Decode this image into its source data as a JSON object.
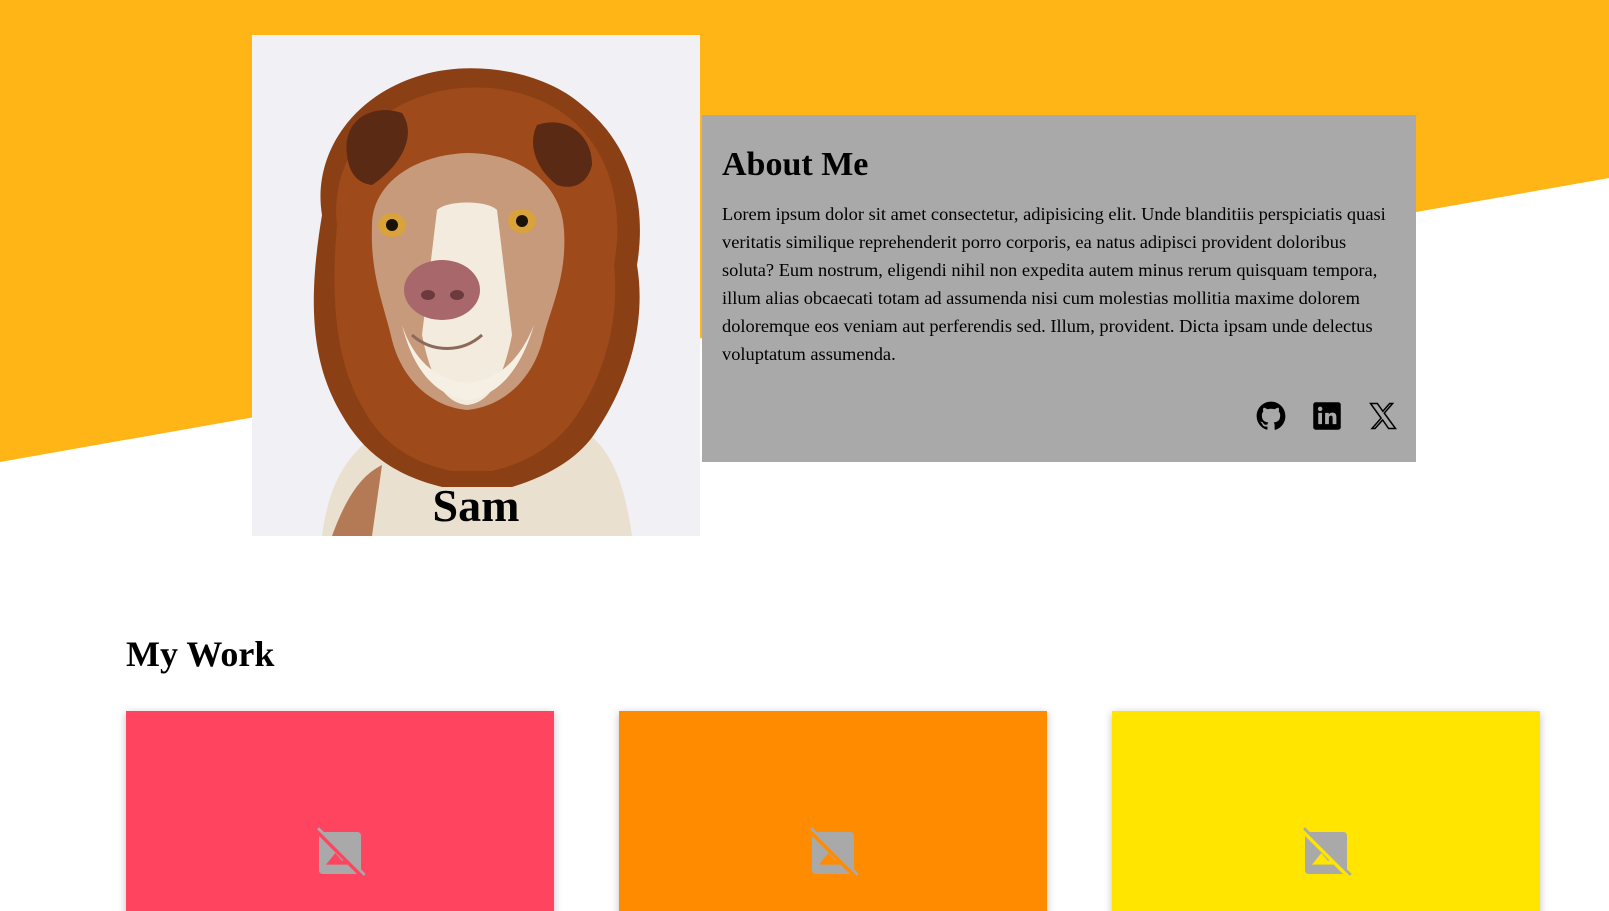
{
  "profile": {
    "name": "Sam",
    "photo_alt": "dog-in-lion-hood-photo"
  },
  "about": {
    "heading": "About Me",
    "body": "Lorem ipsum dolor sit amet consectetur, adipisicing elit. Unde blanditiis perspiciatis quasi veritatis similique reprehenderit porro corporis, ea natus adipisci provident doloribus soluta? Eum nostrum, eligendi nihil non expedita autem minus rerum quisquam tempora, illum alias obcaecati totam ad assumenda nisi cum molestias mollitia maxime dolorem doloremque eos veniam aut perferendis sed. Illum, provident. Dicta ipsam unde delectus voluptatum assumenda.",
    "social_icons": [
      "github-icon",
      "linkedin-icon",
      "x-twitter-icon"
    ]
  },
  "work": {
    "heading": "My Work",
    "cards": [
      {
        "color": "#ff4460",
        "icon": "image-unavailable-icon"
      },
      {
        "color": "#ff8c00",
        "icon": "image-unavailable-icon"
      },
      {
        "color": "#ffe500",
        "icon": "image-unavailable-icon"
      }
    ]
  },
  "colors": {
    "hero_bg": "#ffb516",
    "about_card_bg": "#a9a9a9",
    "photo_bg": "#f1f0f5"
  }
}
